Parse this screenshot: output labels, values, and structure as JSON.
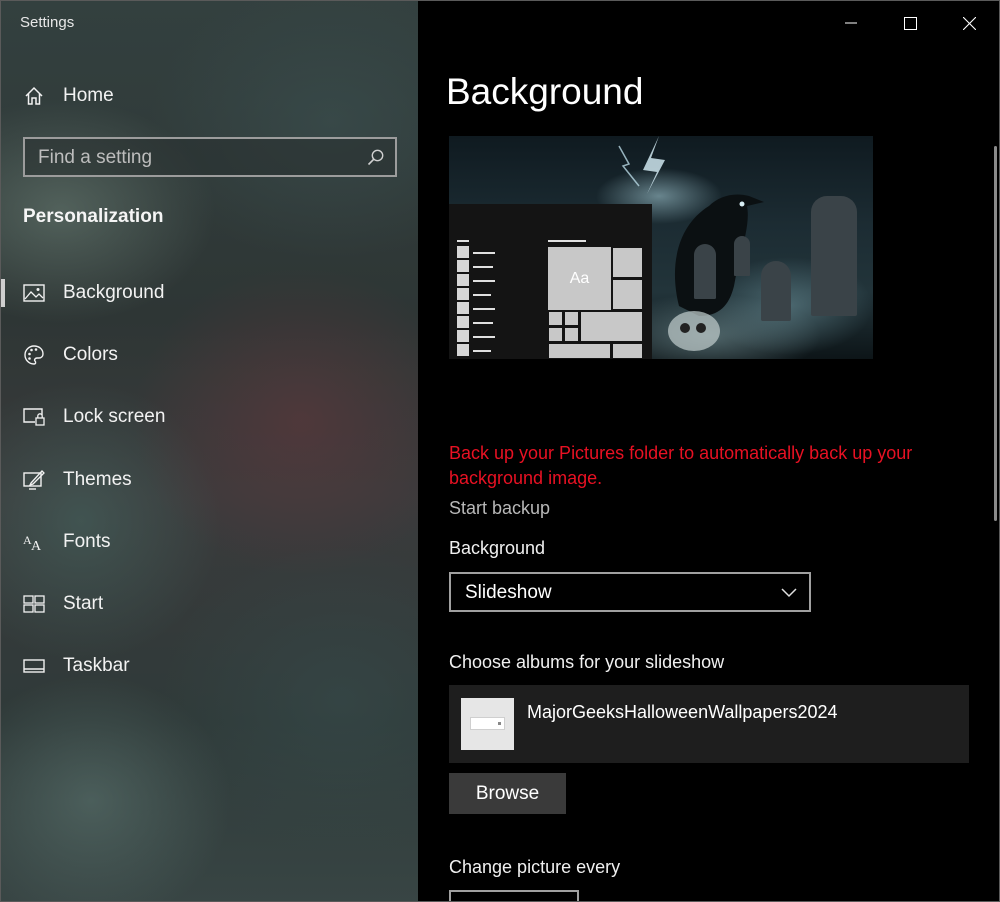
{
  "window": {
    "title": "Settings"
  },
  "sidebar": {
    "home_label": "Home",
    "search_placeholder": "Find a setting",
    "section_heading": "Personalization",
    "items": [
      {
        "label": "Background",
        "icon": "picture-icon",
        "active": true
      },
      {
        "label": "Colors",
        "icon": "palette-icon"
      },
      {
        "label": "Lock screen",
        "icon": "lock-screen-icon"
      },
      {
        "label": "Themes",
        "icon": "themes-icon"
      },
      {
        "label": "Fonts",
        "icon": "fonts-icon"
      },
      {
        "label": "Start",
        "icon": "start-icon"
      },
      {
        "label": "Taskbar",
        "icon": "taskbar-icon"
      }
    ]
  },
  "main": {
    "page_title": "Background",
    "preview": {
      "tile_label": "Aa"
    },
    "backup_warning": "Back up your Pictures folder to automatically back up your background image.",
    "start_backup_link": "Start backup",
    "background_label": "Background",
    "background_value": "Slideshow",
    "albums_label": "Choose albums for your slideshow",
    "album_name": "MajorGeeksHalloweenWallpapers2024",
    "browse_label": "Browse",
    "change_picture_label": "Change picture every"
  },
  "colors": {
    "warning": "#e81123",
    "accent": "#cfcfcf"
  }
}
